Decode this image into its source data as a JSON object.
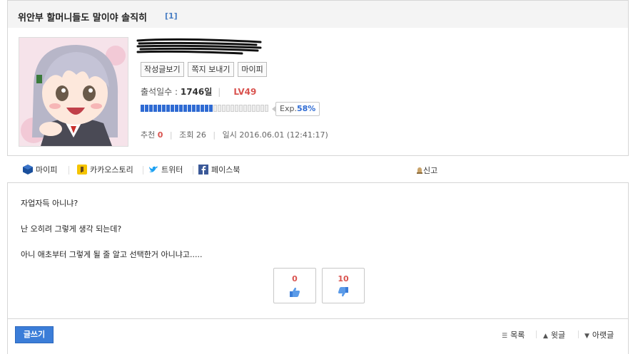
{
  "post": {
    "title": "위안부 할머니들도 말이야 솔직히",
    "comment_count": "[1]"
  },
  "author": {
    "buttons": [
      "작성글보기",
      "쪽지 보내기",
      "마이피"
    ],
    "attendance_label": "출석일수 : ",
    "attendance_value": "1746일",
    "level": "LV49",
    "exp_label": "Exp.",
    "exp_percent": "58%",
    "exp_fraction": 0.58
  },
  "stats": {
    "recommend_label": "추천",
    "recommend_value": "0",
    "views_label": "조회",
    "views_value": "26",
    "date_label": "일시",
    "date_value": "2016.06.01 (12:41:17)"
  },
  "share": {
    "items": [
      {
        "label": "마이피",
        "icon": "mypi-icon",
        "color": "#1a4f9c"
      },
      {
        "label": "카카오스토리",
        "icon": "kakaostory-icon",
        "color": "#f5c400"
      },
      {
        "label": "트위터",
        "icon": "twitter-icon",
        "color": "#1da1f2"
      },
      {
        "label": "페이스북",
        "icon": "facebook-icon",
        "color": "#3b5998"
      }
    ],
    "report_label": "신고"
  },
  "body": {
    "lines": [
      "자업자득 아니냐?",
      "난 오히려 그렇게 생각 되는데?",
      "아니 애초부터 그렇게 될 줄 알고 선택한거 아니냐고....."
    ]
  },
  "votes": {
    "up": "0",
    "down": "10"
  },
  "footer": {
    "write_label": "글쓰기",
    "list_label": "목록",
    "up_label": "윗글",
    "down_label": "아랫글"
  }
}
